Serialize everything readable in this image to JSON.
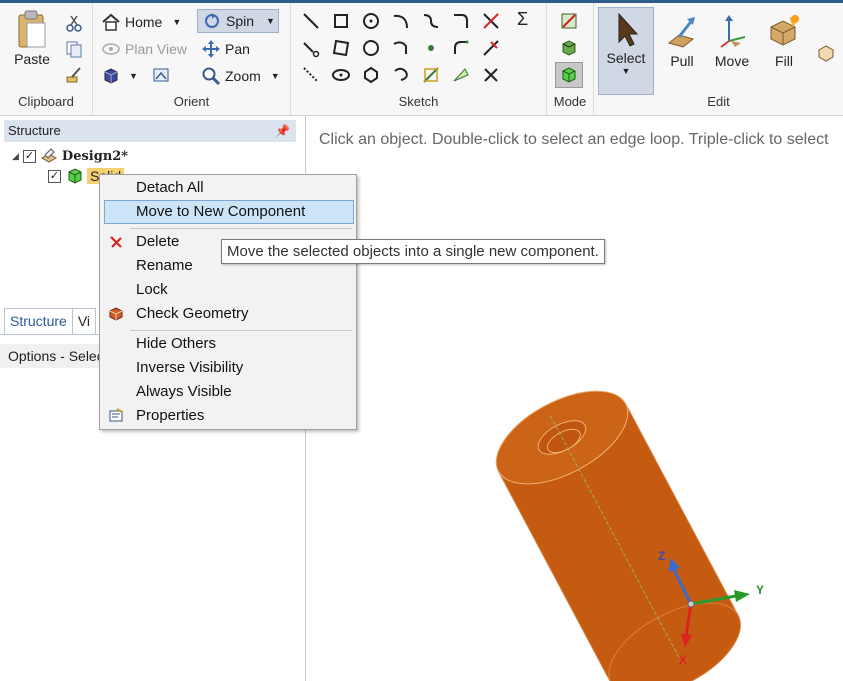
{
  "ribbon": {
    "clipboard": {
      "paste": "Paste",
      "label": "Clipboard"
    },
    "orient": {
      "home": "Home",
      "plan_view": "Plan View",
      "spin": "Spin",
      "pan": "Pan",
      "zoom": "Zoom",
      "label": "Orient"
    },
    "sketch": {
      "label": "Sketch",
      "sigma": "Σ"
    },
    "mode": {
      "label": "Mode"
    },
    "edit": {
      "select": "Select",
      "pull": "Pull",
      "move": "Move",
      "fill": "Fill",
      "label": "Edit"
    }
  },
  "structure": {
    "title": "Structure",
    "pin": "ᵖ",
    "design": "Design2*",
    "solid_item": "Solid",
    "tabs": [
      "Structure",
      "Vi"
    ],
    "options_label": "Options - Selec"
  },
  "viewport": {
    "hint": "Click an object. Double-click to select an edge loop. Triple-click to select",
    "axes": {
      "z": "Z",
      "x": "X",
      "y": "Y"
    }
  },
  "context_menu": {
    "items": [
      "Detach All",
      "Move to New Component",
      "Delete",
      "Rename",
      "Lock",
      "Check Geometry",
      "Hide Others",
      "Inverse Visibility",
      "Always Visible",
      "Properties"
    ],
    "highlighted_index": 1
  },
  "tooltip": "Move the selected objects into a single new component.",
  "colors": {
    "solid": "#c55a11",
    "menu_highlight": "#cde4f7",
    "panel_header": "#dae3ee"
  }
}
